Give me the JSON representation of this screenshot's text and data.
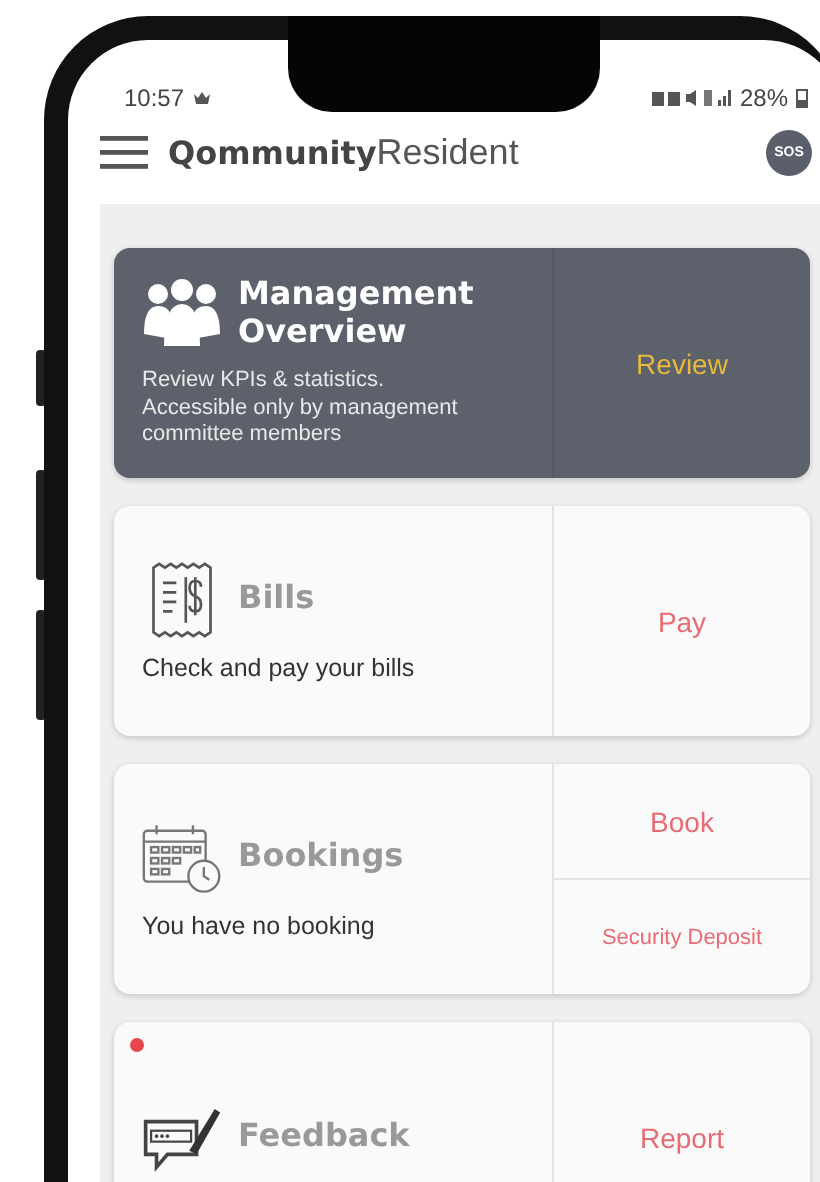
{
  "status_bar": {
    "time": "10:57",
    "battery": "28%"
  },
  "app_bar": {
    "title_bold": "Qommunity",
    "title_regular": "Resident",
    "sos": "SOS"
  },
  "cards": [
    {
      "kind": "dark",
      "title": "Management Overview",
      "description": "Review KPIs & statistics. Accessible only by management committee members",
      "notification": false,
      "actions": [
        "Review"
      ]
    },
    {
      "kind": "light",
      "title": "Bills",
      "description": "Check and pay your bills",
      "notification": false,
      "actions": [
        "Pay"
      ]
    },
    {
      "kind": "light",
      "title": "Bookings",
      "description": "You have no booking",
      "notification": false,
      "actions": [
        "Book",
        "Security Deposit"
      ]
    },
    {
      "kind": "light",
      "title": "Feedback",
      "notification": true,
      "actions": [
        "Report"
      ]
    }
  ]
}
